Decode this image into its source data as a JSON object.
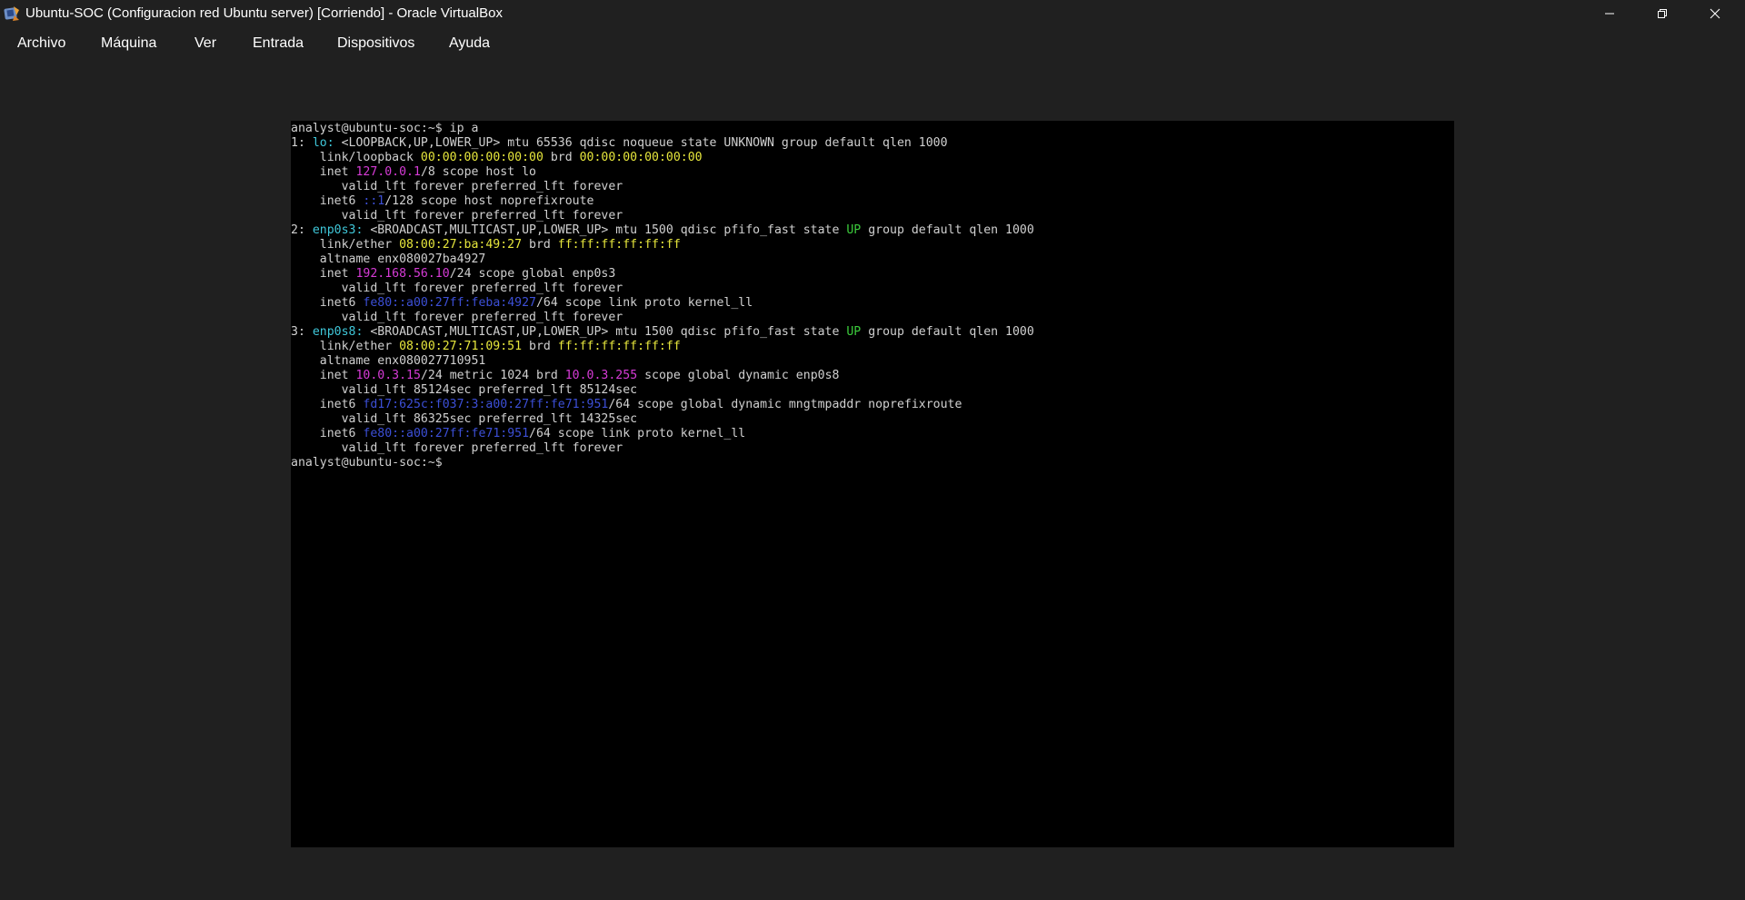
{
  "window": {
    "title": "Ubuntu-SOC (Configuracion red Ubuntu server) [Corriendo] - Oracle VirtualBox",
    "app_icon": "virtualbox-icon",
    "controls": [
      "minimize-icon",
      "restore-icon",
      "close-icon"
    ]
  },
  "menu": {
    "items": [
      "Archivo",
      "Máquina",
      "Ver",
      "Entrada",
      "Dispositivos",
      "Ayuda"
    ]
  },
  "colors": {
    "window_bg": "#202020",
    "terminal_bg": "#000000",
    "text_default": "#d0d0d0",
    "iface_cyan": "#3fc7d9",
    "mac_yellow": "#e6e63c",
    "ipv4_magenta": "#d63bd6",
    "ipv6_blue": "#3c4fd6",
    "state_green": "#3ccc3c"
  },
  "terminal": {
    "lines": [
      [
        {
          "t": "analyst@ubuntu-soc:~$ ip a"
        }
      ],
      [
        {
          "t": "1: "
        },
        {
          "t": "lo:",
          "c": "iface_cyan"
        },
        {
          "t": " <LOOPBACK,UP,LOWER_UP> mtu 65536 qdisc noqueue state UNKNOWN group default qlen 1000"
        }
      ],
      [
        {
          "t": "    link/loopback "
        },
        {
          "t": "00:00:00:00:00:00",
          "c": "mac_yellow"
        },
        {
          "t": " brd "
        },
        {
          "t": "00:00:00:00:00:00",
          "c": "mac_yellow"
        }
      ],
      [
        {
          "t": "    inet "
        },
        {
          "t": "127.0.0.1",
          "c": "ipv4_magenta"
        },
        {
          "t": "/8 scope host lo"
        }
      ],
      [
        {
          "t": "       valid_lft forever preferred_lft forever"
        }
      ],
      [
        {
          "t": "    inet6 "
        },
        {
          "t": "::1",
          "c": "ipv6_blue"
        },
        {
          "t": "/128 scope host noprefixroute"
        }
      ],
      [
        {
          "t": "       valid_lft forever preferred_lft forever"
        }
      ],
      [
        {
          "t": "2: "
        },
        {
          "t": "enp0s3:",
          "c": "iface_cyan"
        },
        {
          "t": " <BROADCAST,MULTICAST,UP,LOWER_UP> mtu 1500 qdisc pfifo_fast state "
        },
        {
          "t": "UP",
          "c": "state_green"
        },
        {
          "t": " group default qlen 1000"
        }
      ],
      [
        {
          "t": "    link/ether "
        },
        {
          "t": "08:00:27:ba:49:27",
          "c": "mac_yellow"
        },
        {
          "t": " brd "
        },
        {
          "t": "ff:ff:ff:ff:ff:ff",
          "c": "mac_yellow"
        }
      ],
      [
        {
          "t": "    altname enx080027ba4927"
        }
      ],
      [
        {
          "t": "    inet "
        },
        {
          "t": "192.168.56.10",
          "c": "ipv4_magenta"
        },
        {
          "t": "/24 scope global enp0s3"
        }
      ],
      [
        {
          "t": "       valid_lft forever preferred_lft forever"
        }
      ],
      [
        {
          "t": "    inet6 "
        },
        {
          "t": "fe80::a00:27ff:feba:4927",
          "c": "ipv6_blue"
        },
        {
          "t": "/64 scope link proto kernel_ll"
        }
      ],
      [
        {
          "t": "       valid_lft forever preferred_lft forever"
        }
      ],
      [
        {
          "t": "3: "
        },
        {
          "t": "enp0s8:",
          "c": "iface_cyan"
        },
        {
          "t": " <BROADCAST,MULTICAST,UP,LOWER_UP> mtu 1500 qdisc pfifo_fast state "
        },
        {
          "t": "UP",
          "c": "state_green"
        },
        {
          "t": " group default qlen 1000"
        }
      ],
      [
        {
          "t": "    link/ether "
        },
        {
          "t": "08:00:27:71:09:51",
          "c": "mac_yellow"
        },
        {
          "t": " brd "
        },
        {
          "t": "ff:ff:ff:ff:ff:ff",
          "c": "mac_yellow"
        }
      ],
      [
        {
          "t": "    altname enx080027710951"
        }
      ],
      [
        {
          "t": "    inet "
        },
        {
          "t": "10.0.3.15",
          "c": "ipv4_magenta"
        },
        {
          "t": "/24 metric 1024 brd "
        },
        {
          "t": "10.0.3.255",
          "c": "ipv4_magenta"
        },
        {
          "t": " scope global dynamic enp0s8"
        }
      ],
      [
        {
          "t": "       valid_lft 85124sec preferred_lft 85124sec"
        }
      ],
      [
        {
          "t": "    inet6 "
        },
        {
          "t": "fd17:625c:f037:3:a00:27ff:fe71:951",
          "c": "ipv6_blue"
        },
        {
          "t": "/64 scope global dynamic mngtmpaddr noprefixroute"
        }
      ],
      [
        {
          "t": "       valid_lft 86325sec preferred_lft 14325sec"
        }
      ],
      [
        {
          "t": "    inet6 "
        },
        {
          "t": "fe80::a00:27ff:fe71:951",
          "c": "ipv6_blue"
        },
        {
          "t": "/64 scope link proto kernel_ll"
        }
      ],
      [
        {
          "t": "       valid_lft forever preferred_lft forever"
        }
      ],
      [
        {
          "t": "analyst@ubuntu-soc:~$ "
        }
      ]
    ]
  }
}
